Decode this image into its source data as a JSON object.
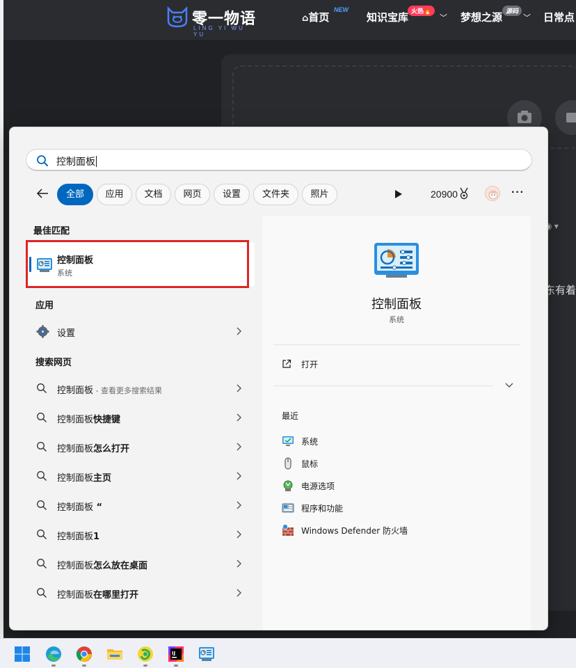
{
  "website": {
    "logo_title": "零一物语",
    "logo_subtitle": "LING YI WU YU",
    "nav": [
      {
        "label": "首页",
        "badge": "NEW",
        "home_icon": true
      },
      {
        "label": "知识宝库",
        "badge": "火热🔥"
      },
      {
        "label": "梦想之源",
        "badge": "源码"
      },
      {
        "label": "日常点"
      }
    ],
    "peek_text_1": "◉ ▾",
    "peek_text_2": "东有着扌"
  },
  "search": {
    "query": "控制面板",
    "icon": "search-icon"
  },
  "filters": {
    "items": [
      "全部",
      "应用",
      "文档",
      "网页",
      "设置",
      "文件夹",
      "照片"
    ],
    "active_index": 0
  },
  "toolbar": {
    "points": "20900",
    "more_label": "···"
  },
  "best_match": {
    "section_title": "最佳匹配",
    "title": "控制面板",
    "subtitle": "系统",
    "icon": "control-panel-icon"
  },
  "apps": {
    "section_title": "应用",
    "items": [
      {
        "label": "设置",
        "icon": "settings-gear-icon"
      }
    ]
  },
  "web": {
    "section_title": "搜索网页",
    "items": [
      {
        "label": "控制面板",
        "hint": " - 查看更多搜索结果"
      },
      {
        "label": "控制面板",
        "bold_suffix": "快捷键"
      },
      {
        "label": "控制面板",
        "bold_suffix": "怎么打开"
      },
      {
        "label": "控制面板",
        "bold_suffix": "主页"
      },
      {
        "label": "控制面板",
        "bold_suffix": " “"
      },
      {
        "label": "控制面板",
        "bold_suffix": "1"
      },
      {
        "label": "控制面板",
        "bold_suffix": "怎么放在桌面"
      },
      {
        "label": "控制面板",
        "bold_suffix": "在哪里打开"
      }
    ]
  },
  "detail": {
    "title": "控制面板",
    "subtitle": "系统",
    "open_label": "打开",
    "recent_title": "最近",
    "recent": [
      {
        "label": "系统",
        "icon": "system-monitor-icon"
      },
      {
        "label": "鼠标",
        "icon": "mouse-icon"
      },
      {
        "label": "电源选项",
        "icon": "power-options-icon"
      },
      {
        "label": "程序和功能",
        "icon": "programs-features-icon"
      },
      {
        "label": "Windows Defender 防火墙",
        "icon": "firewall-icon"
      }
    ]
  },
  "taskbar": {
    "apps": [
      "windows-start-icon",
      "edge-icon",
      "chrome-icon",
      "file-explorer-icon",
      "qq-music-icon",
      "intellij-idea-icon",
      "control-panel-taskbar-icon"
    ]
  },
  "colors": {
    "accent": "#0067c0",
    "highlight_box": "#e02424",
    "panel_bg": "#f3f3f3",
    "site_header_bg": "#2b2c30"
  }
}
